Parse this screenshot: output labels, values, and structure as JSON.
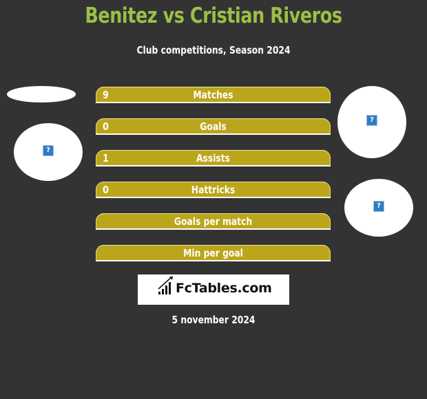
{
  "header": {
    "title": "Benitez vs Cristian Riveros",
    "subtitle": "Club competitions, Season 2024"
  },
  "colors": {
    "background": "#333333",
    "title": "#9cbf47",
    "bar": "#bba51a",
    "text": "#ffffff"
  },
  "stats": [
    {
      "label": "Matches",
      "left_value": "9"
    },
    {
      "label": "Goals",
      "left_value": "0"
    },
    {
      "label": "Assists",
      "left_value": "1"
    },
    {
      "label": "Hattricks",
      "left_value": "0"
    },
    {
      "label": "Goals per match",
      "left_value": ""
    },
    {
      "label": "Min per goal",
      "left_value": ""
    }
  ],
  "images": {
    "placeholder_icon": "?"
  },
  "logo": {
    "text": "FcTables.com",
    "icon": "bar-chart-icon"
  },
  "footer": {
    "date": "5 november 2024"
  }
}
